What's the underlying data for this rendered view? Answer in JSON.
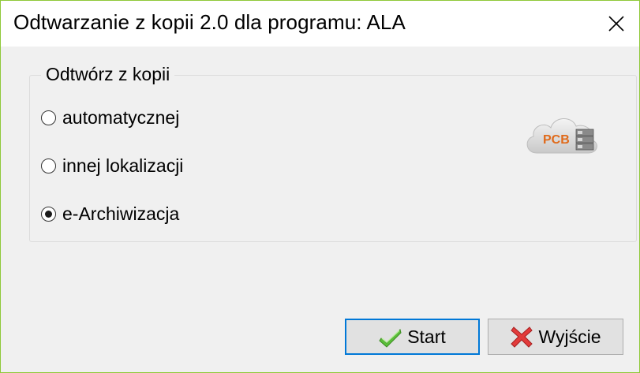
{
  "window": {
    "title": "Odtwarzanie z kopii 2.0 dla programu: ALA",
    "border_color": "#8fc93a"
  },
  "group": {
    "legend": "Odtwórz z kopii",
    "options": [
      {
        "label": "automatycznej",
        "selected": false
      },
      {
        "label": "innej lokalizacji",
        "selected": false
      },
      {
        "label": "e-Archiwizacja",
        "selected": true
      }
    ],
    "logo_icon": "cloud-pcb-database-icon",
    "logo_text": "PCB"
  },
  "buttons": {
    "start_label": "Start",
    "start_icon": "green-checkmark-icon",
    "exit_label": "Wyjście",
    "exit_icon": "red-x-icon",
    "accent_color": "#0078d7"
  }
}
